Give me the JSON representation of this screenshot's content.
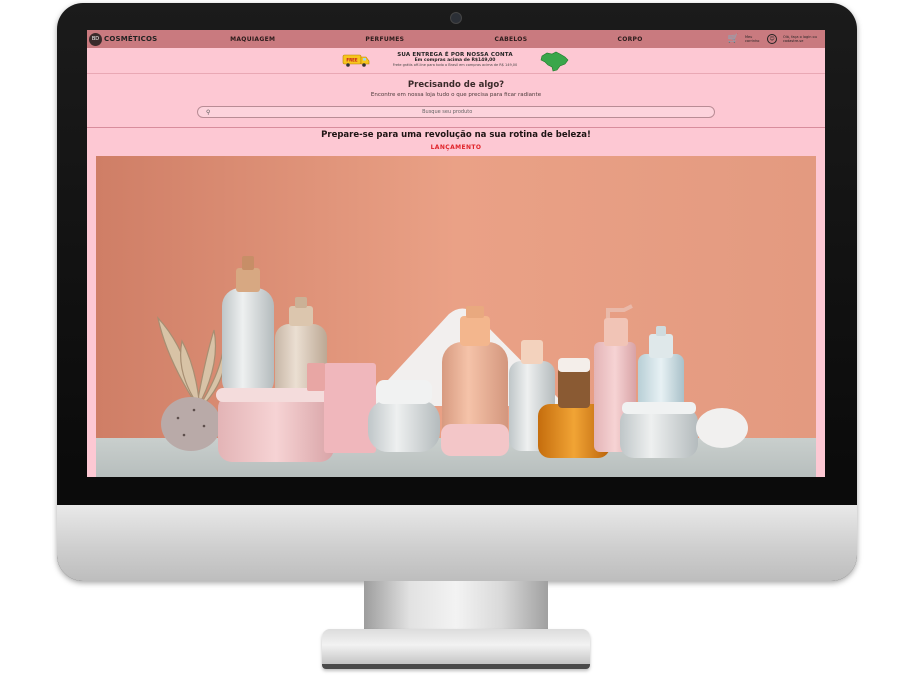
{
  "nav": {
    "logo_text": "COSMÉTICOS",
    "logo_badge": "BD",
    "items": [
      {
        "label": "MAQUIAGEM"
      },
      {
        "label": "PERFUMES"
      },
      {
        "label": "CABELOS"
      },
      {
        "label": "CORPO"
      }
    ],
    "cart_label": "Meu carrinho",
    "login_label": "Olá, faça o login ou cadastre-se",
    "cart_icon": "cart-icon",
    "user_icon": "user-icon"
  },
  "delivery": {
    "title": "SUA ENTREGA É POR NOSSA CONTA",
    "subtitle": "Em compras acima de R$149,00",
    "note": "Frete grátis off-line para todo o Brasil em compras acima de R$ 149,00",
    "truck_label": "FREE"
  },
  "search": {
    "title": "Precisando de algo?",
    "subtitle": "Encontre em nossa loja tudo o que precisa para ficar radiante",
    "placeholder": "Busque seu produto"
  },
  "hero": {
    "headline": "Prepare-se para uma revolução na sua rotina de beleza!",
    "tag": "LANÇAMENTO"
  },
  "colors": {
    "navbar": "#c97a7f",
    "page_bg": "#fdc8d3",
    "launch_red": "#e0242a",
    "hero_wall": "#e9957c"
  }
}
